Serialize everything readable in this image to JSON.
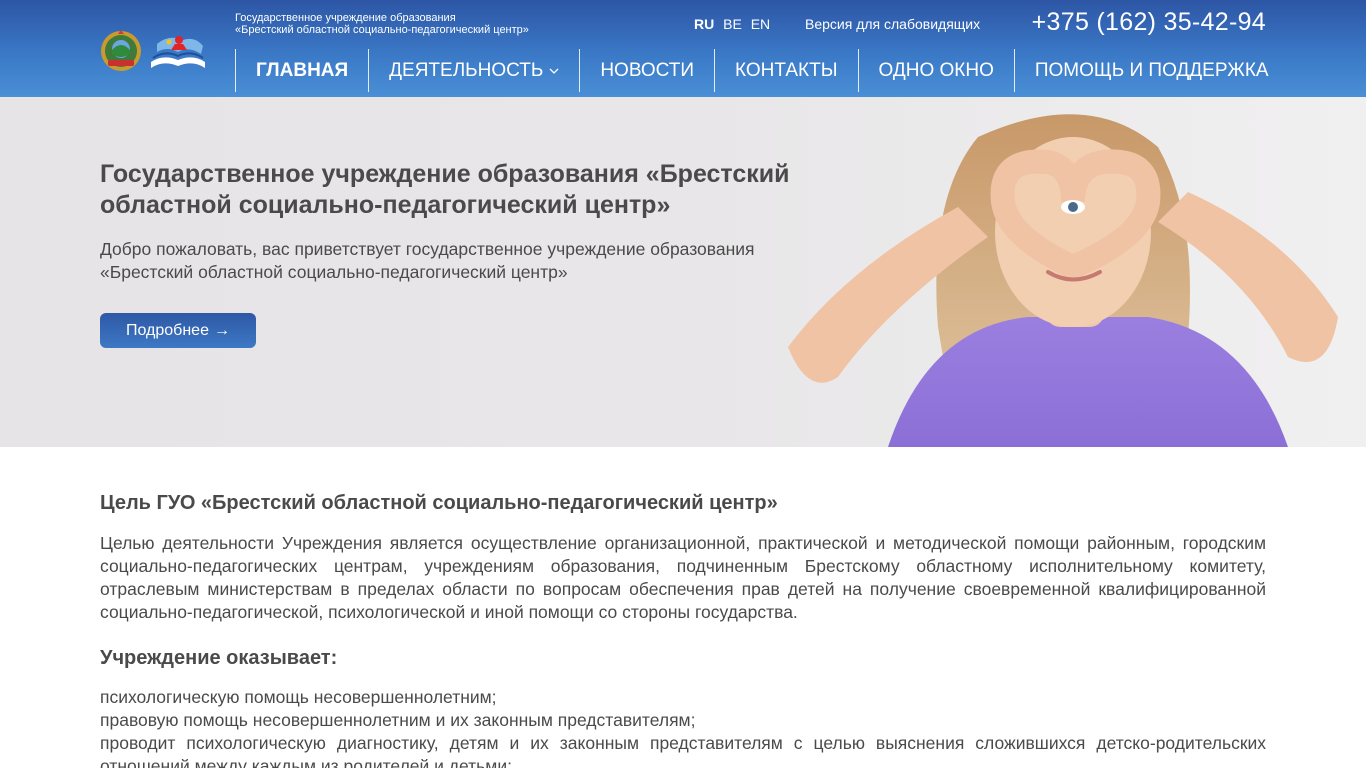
{
  "header": {
    "org_line1": "Государственное учреждение образования",
    "org_line2": "«Брестский областной социально-педагогический центр»",
    "languages": [
      "RU",
      "BE",
      "EN"
    ],
    "active_language": "RU",
    "low_vision_label": "Версия для слабовидящих",
    "phone": "+375 (162) 35-42-94"
  },
  "nav": {
    "items": [
      {
        "label": "Главная",
        "active": true
      },
      {
        "label": "Деятельность",
        "dropdown": true
      },
      {
        "label": "Новости"
      },
      {
        "label": "Контакты"
      },
      {
        "label": "Одно окно"
      },
      {
        "label": "Помощь и поддержка"
      }
    ]
  },
  "hero": {
    "title": "Государственное учреждение образования «Брестский областной социально-педагогический центр»",
    "text": "Добро пожаловать, вас приветствует государственное учреждение образования «Брестский областной социально-педагогический центр»",
    "button_label": "Подробнее",
    "button_icon": "arrow-right-icon"
  },
  "content": {
    "goal_heading": "Цель ГУО «Брестский областной социально-педагогический центр»",
    "goal_text": "Целью деятельности Учреждения является осуществление организационной, практической и методической помощи районным, городским социально-педагогических центрам, учреждениям образования, подчиненным Брестскому областному исполнительному комитету, отраслевым министерствам в пределах области по вопросам обеспечения прав детей на получение своевременной квалифицированной социально-педагогической, психологической и иной помощи со стороны государства.",
    "services_heading": "Учреждение оказывает:",
    "services": [
      "психологическую помощь несовершеннолетним;",
      "правовую помощь несовершеннолетним и их законным представителям;",
      "проводит психологическую диагностику, детям и их законным представителям с целью выяснения сложившихся детско-родительских отношений между каждым из родителей и детьми;"
    ]
  },
  "colors": {
    "header_top": "#2d56a5",
    "header_bottom": "#4a8fd6",
    "button": "#2e58a6",
    "text": "#4a4a4a"
  }
}
